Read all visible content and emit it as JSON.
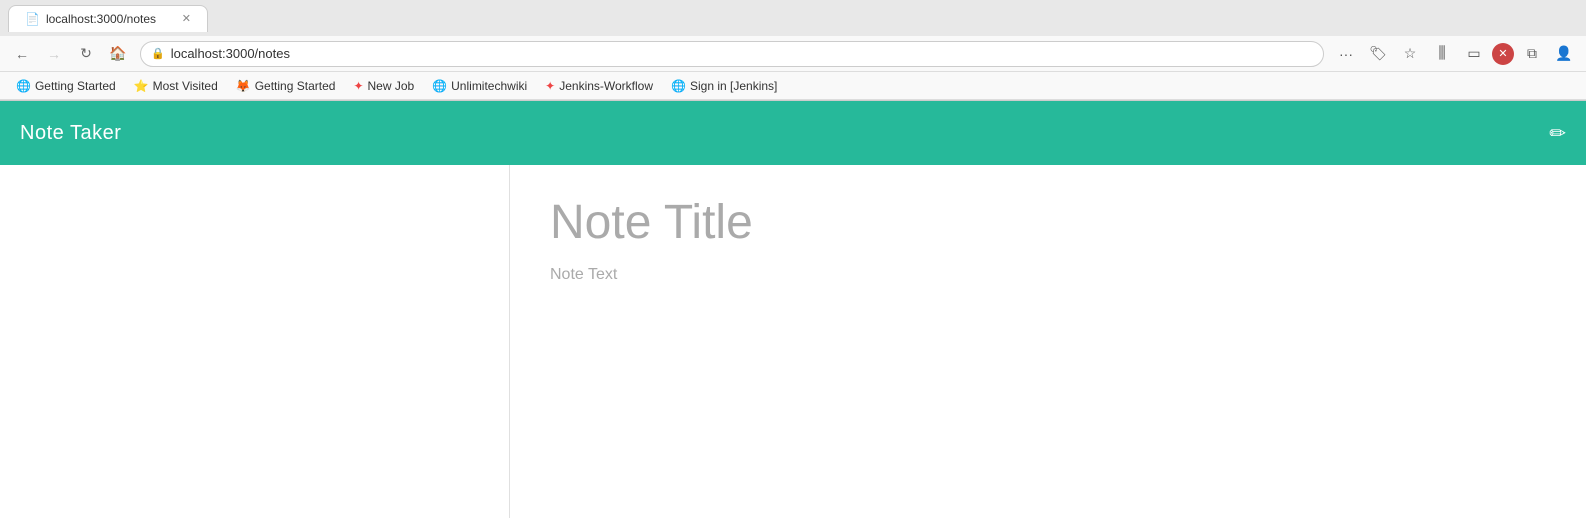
{
  "browser": {
    "tab": {
      "title": "localhost:3000/notes",
      "favicon": "📄"
    },
    "nav": {
      "url": "localhost:3000/notes",
      "back_disabled": false,
      "forward_disabled": true
    },
    "nav_buttons": {
      "more_label": "···",
      "pocket_label": "🏷",
      "star_label": "☆",
      "library_label": "|||",
      "sidebar_label": "▭",
      "close_tab_label": "✕",
      "sync_label": "👤"
    },
    "bookmarks": [
      {
        "id": "getting-started-1",
        "label": "Getting Started",
        "icon": "🌐"
      },
      {
        "id": "most-visited",
        "label": "Most Visited",
        "icon": "⭐"
      },
      {
        "id": "getting-started-2",
        "label": "Getting Started",
        "icon": "🦊"
      },
      {
        "id": "new-job",
        "label": "New Job",
        "icon": "❇"
      },
      {
        "id": "unlimitechwiki",
        "label": "Unlimitechwiki",
        "icon": "🌐"
      },
      {
        "id": "jenkins-workflow",
        "label": "Jenkins-Workflow",
        "icon": "❇"
      },
      {
        "id": "sign-in-jenkins",
        "label": "Sign in [Jenkins]",
        "icon": "🌐"
      }
    ]
  },
  "app": {
    "title": "Note Taker",
    "pencil_icon": "✏"
  },
  "note": {
    "title_placeholder": "Note Title",
    "text_placeholder": "Note Text"
  }
}
